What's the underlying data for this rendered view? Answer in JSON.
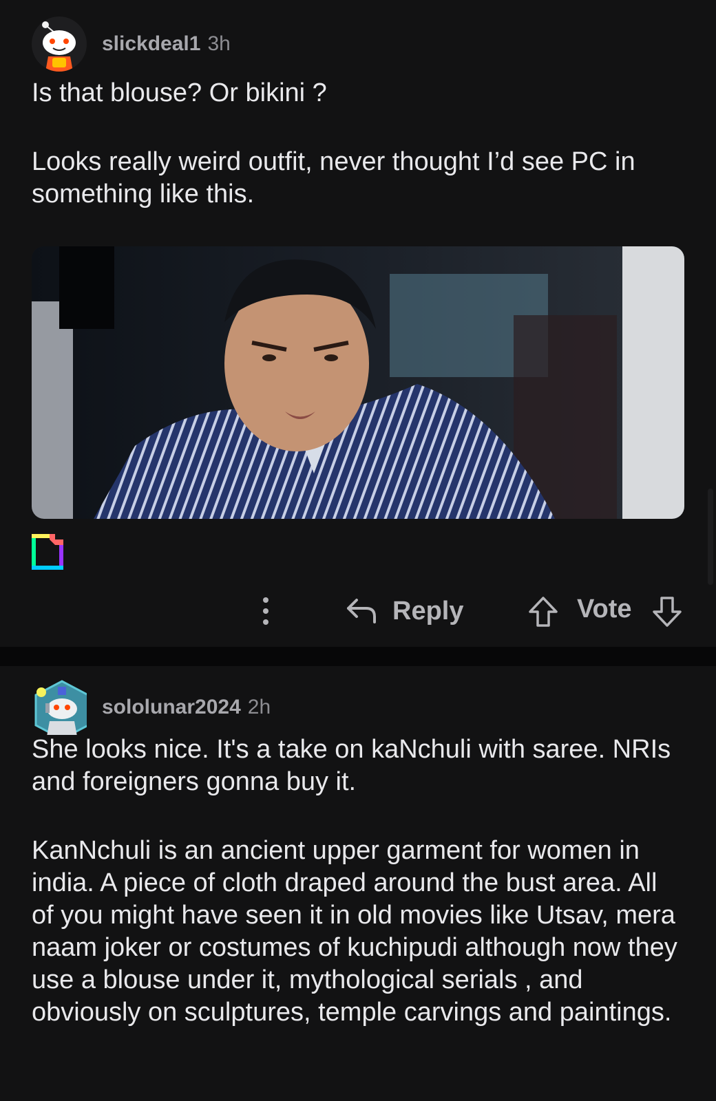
{
  "comments": [
    {
      "username": "slickdeal1",
      "time": "3h",
      "paragraphs": [
        "Is that blouse? Or bikini ?",
        "Looks really weird outfit, never thought I’d see PC in something like this."
      ],
      "actions": {
        "reply_label": "Reply",
        "vote_label": "Vote"
      }
    },
    {
      "username": "sololunar2024",
      "time": "2h",
      "paragraphs": [
        "She looks nice. It's a take on kaNchuli with saree. NRIs and foreigners gonna buy it.",
        "KanNchuli is an ancient upper garment for women in india. A piece of cloth draped around the bust area. All of you might have seen it in old movies like Utsav, mera naam joker or costumes of kuchipudi although now they use a blouse under it, mythological serials , and obviously on sculptures, temple carvings and paintings."
      ]
    }
  ],
  "icons": {
    "more": "more-vertical-icon",
    "reply": "reply-arrow-icon",
    "upvote": "upvote-arrow-icon",
    "downvote": "downvote-arrow-icon",
    "giphy": "giphy-logo-icon"
  },
  "colors": {
    "background": "#121213",
    "divider": "#070708",
    "text_primary": "#e9e9ec",
    "text_secondary": "#a8a8ad",
    "action_text": "#b5b5b9"
  }
}
